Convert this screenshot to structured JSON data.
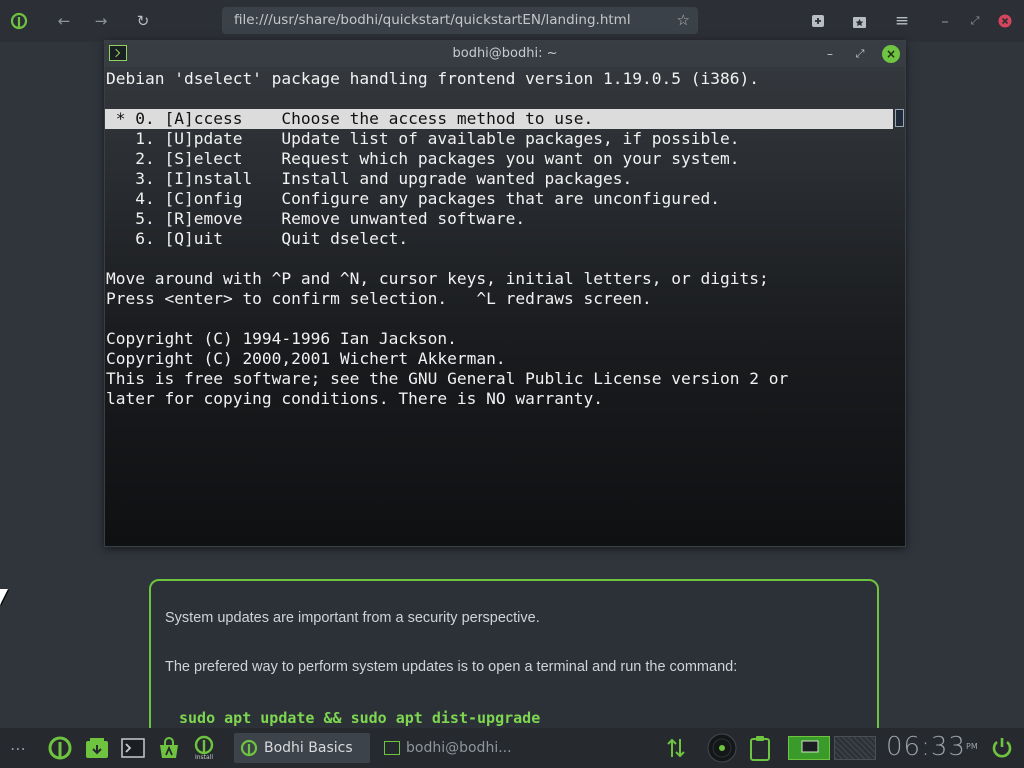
{
  "browser": {
    "url": "file:///usr/share/bodhi/quickstart/quickstartEN/landing.html",
    "icons": [
      "bodhi-logo-icon",
      "back-arrow-icon",
      "forward-arrow-icon",
      "reload-icon",
      "bookmark-star-icon",
      "new-tab-icon",
      "bookmarks-icon",
      "menu-icon",
      "minimize-icon",
      "restore-icon",
      "close-icon"
    ]
  },
  "terminal": {
    "title": "bodhi@bodhi: ~",
    "lines": [
      "Debian 'dselect' package handling frontend version 1.19.0.5 (i386).",
      "",
      " * 0. [A]ccess    Choose the access method to use.",
      "   1. [U]pdate    Update list of available packages, if possible.",
      "   2. [S]elect    Request which packages you want on your system.",
      "   3. [I]nstall   Install and upgrade wanted packages.",
      "   4. [C]onfig    Configure any packages that are unconfigured.",
      "   5. [R]emove    Remove unwanted software.",
      "   6. [Q]uit      Quit dselect.",
      "",
      "Move around with ^P and ^N, cursor keys, initial letters, or digits;",
      "Press <enter> to confirm selection.   ^L redraws screen.",
      "",
      "Copyright (C) 1994-1996 Ian Jackson.",
      "Copyright (C) 2000,2001 Wichert Akkerman.",
      "This is free software; see the GNU General Public License version 2 or",
      "later for copying conditions. There is NO warranty."
    ]
  },
  "info_panel": {
    "line1": "System updates are important from a security perspective.",
    "line2": "The prefered way to perform system updates is to open a terminal and run the command:",
    "command": "sudo apt update && sudo apt dist-upgrade"
  },
  "taskbar": {
    "menu_dots": "⋯",
    "install_label": "Install",
    "tasks": [
      {
        "label": "Bodhi Basics",
        "active": true
      },
      {
        "label": "bodhi@bodhi...",
        "active": false
      }
    ],
    "clock": "06:33",
    "ampm": "PM"
  },
  "colors": {
    "accent": "#6ec43f",
    "terminal_bg": "#1d2024",
    "highlight": "#dcdcdc"
  }
}
